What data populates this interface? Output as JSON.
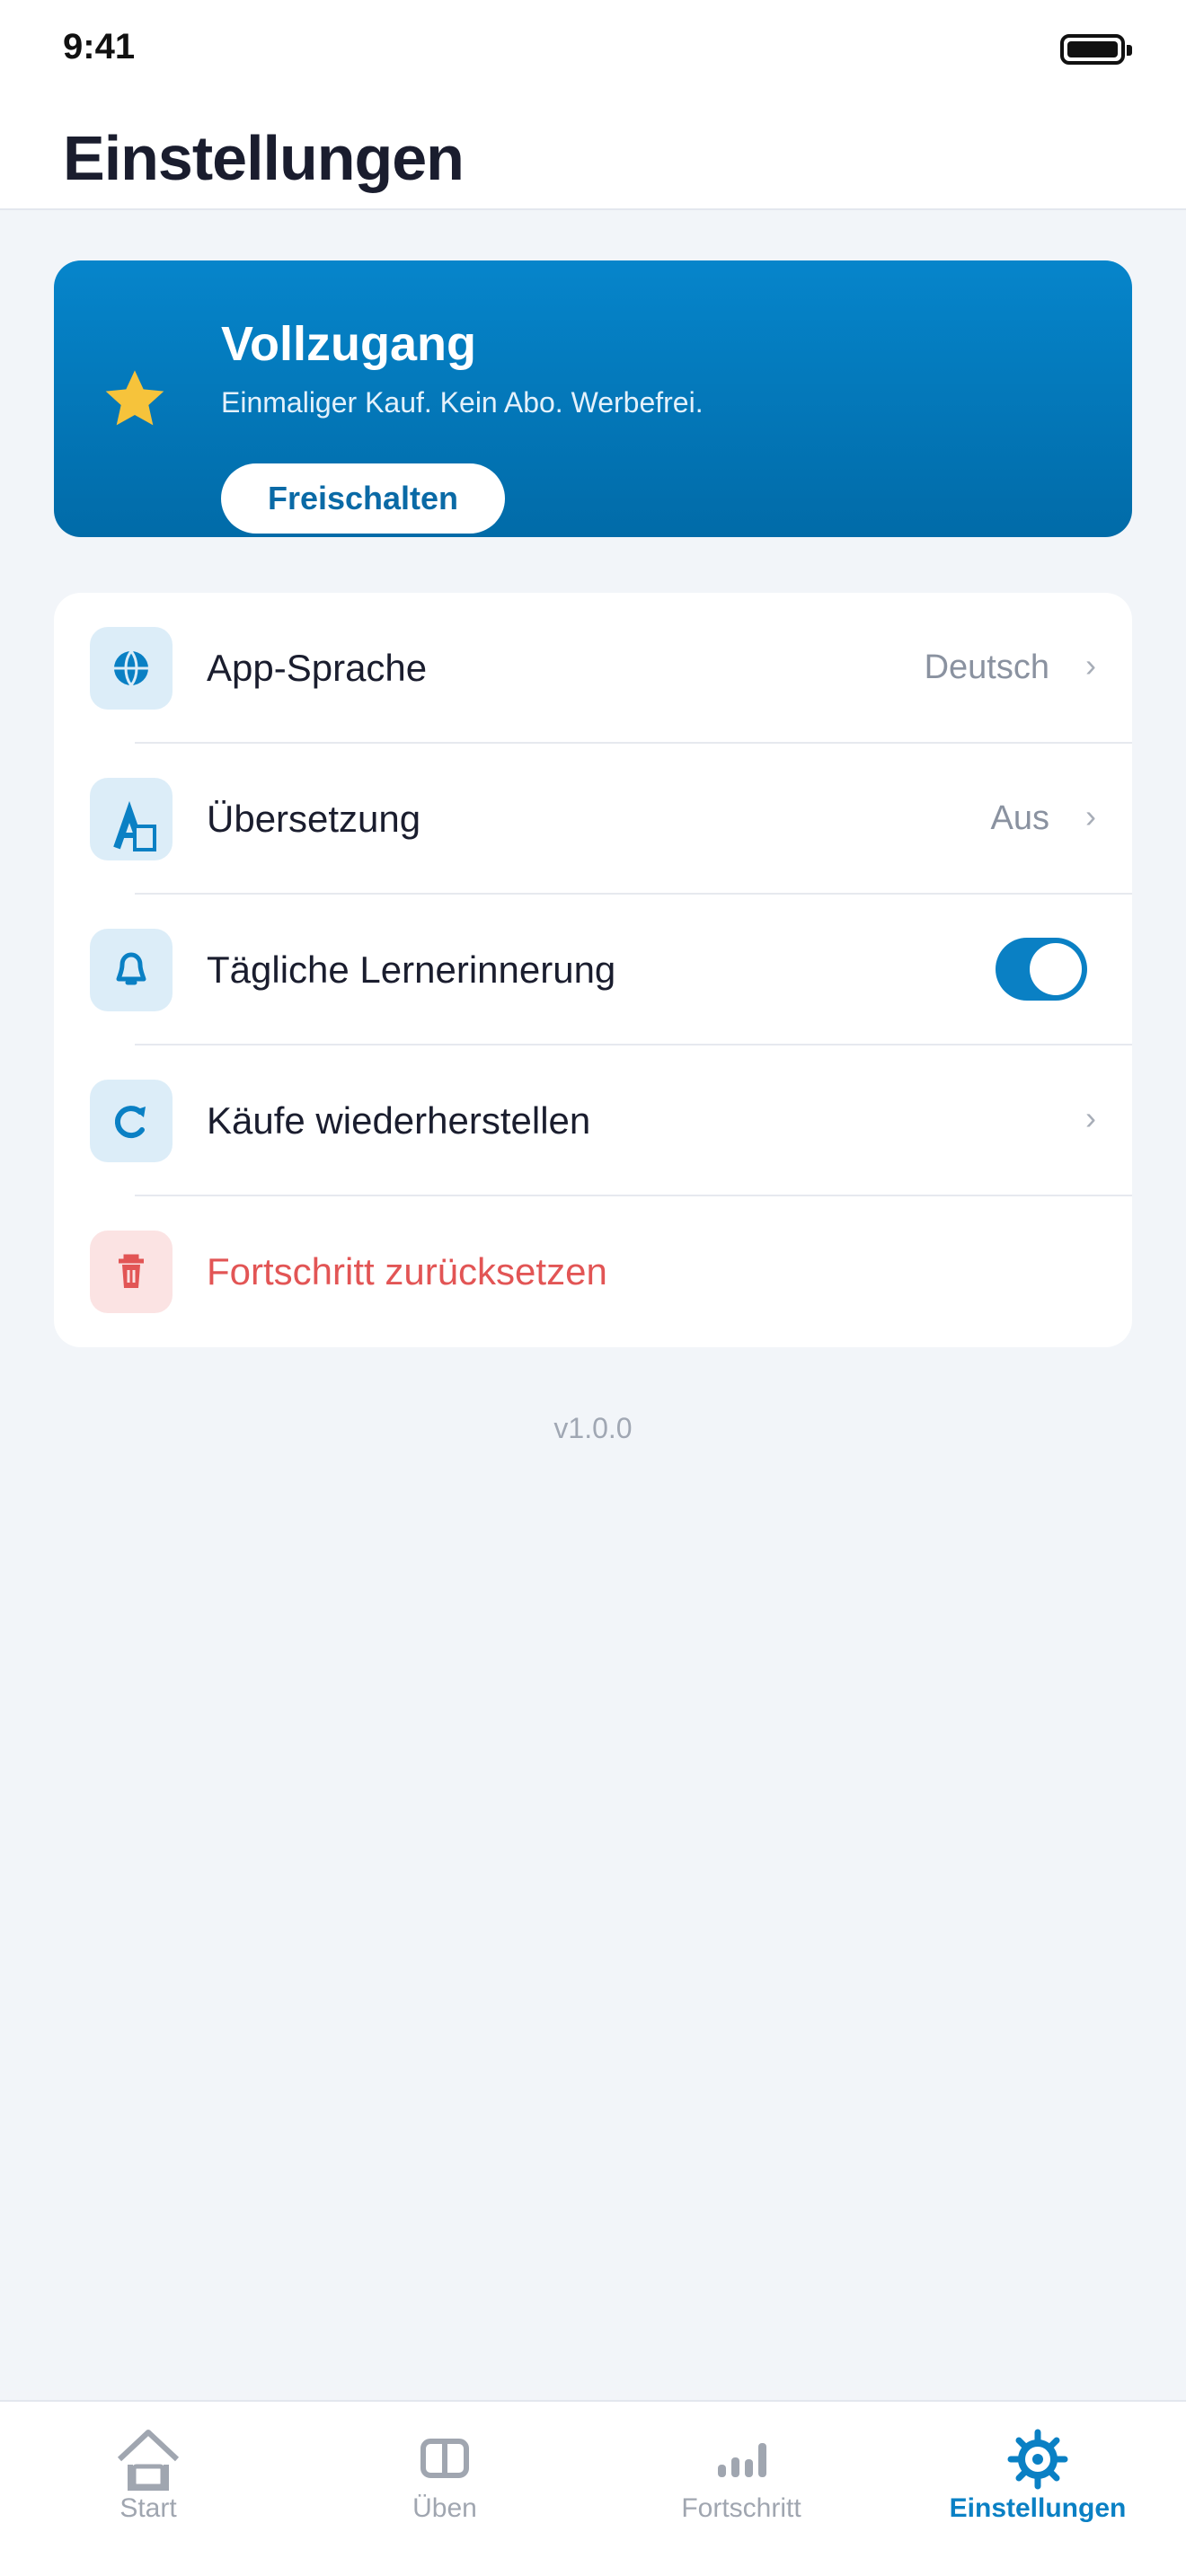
{
  "status_bar": {
    "time": "9:41"
  },
  "header": {
    "title": "Einstellungen"
  },
  "premium": {
    "title": "Vollzugang",
    "subtitle": "Einmaliger Kauf. Kein Abo. Werbefrei.",
    "button_label": "Freischalten",
    "icon": "star-icon",
    "accent_color": "#0685cb"
  },
  "settings": {
    "items": [
      {
        "icon": "globe-icon",
        "label": "App-Sprache",
        "value": "Deutsch",
        "chevron": "›"
      },
      {
        "icon": "translate-icon",
        "label": "Übersetzung",
        "value": "Aus",
        "chevron": "›"
      },
      {
        "icon": "bell-icon",
        "label": "Tägliche Lernerinnerung",
        "toggle_on": true
      },
      {
        "icon": "restore-icon",
        "label": "Käufe wiederherstellen",
        "chevron": "›"
      },
      {
        "icon": "trash-icon",
        "label": "Fortschritt zurücksetzen",
        "danger_color": "#e25555"
      }
    ]
  },
  "version": "v1.0.0",
  "tabbar": {
    "active_color": "#0a80c4",
    "tabs": [
      {
        "label": "Start",
        "icon": "home-icon",
        "active": false
      },
      {
        "label": "Üben",
        "icon": "book-icon",
        "active": false
      },
      {
        "label": "Fortschritt",
        "icon": "chart-icon",
        "active": false
      },
      {
        "label": "Einstellungen",
        "icon": "gear-icon",
        "active": true
      }
    ]
  }
}
